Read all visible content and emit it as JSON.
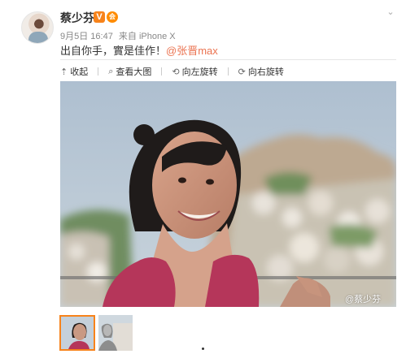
{
  "header": {
    "user_name": "蔡少芬",
    "verified_badge": "V",
    "vip_badge": "会",
    "menu_icon": "chevron-down-icon"
  },
  "meta": {
    "date": "9月5日 16:47",
    "source": "来自 iPhone X"
  },
  "post": {
    "text": "出自你手，實是佳作！",
    "mention": "@张晋max"
  },
  "toolbar": {
    "collapse": "收起",
    "view_large": "查看大图",
    "rotate_left": "向左旋转",
    "rotate_right": "向右旋转"
  },
  "photo": {
    "watermark": "@蔡少芬"
  },
  "thumbnails": {
    "count": 2,
    "selected_index": 0
  },
  "colors": {
    "accent": "#eb7350",
    "orange": "#f7831b",
    "sky": "#b9c9d9",
    "dress": "#b5365a"
  }
}
